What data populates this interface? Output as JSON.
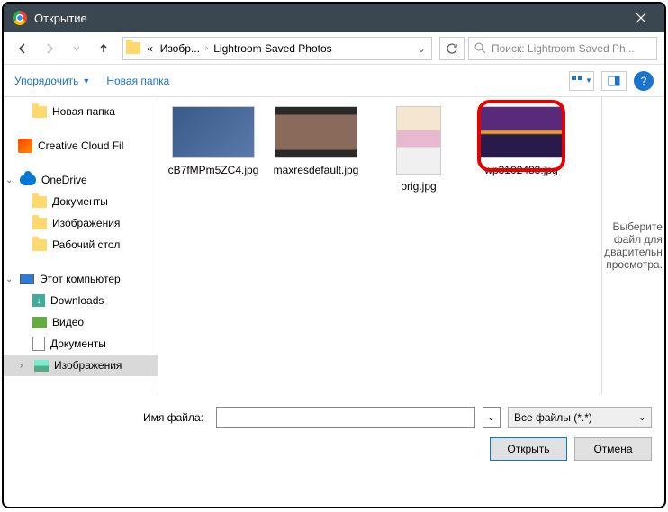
{
  "titlebar": {
    "title": "Открытие"
  },
  "breadcrumb": {
    "prefix": "«",
    "item1": "Изобр...",
    "item2": "Lightroom Saved Photos"
  },
  "search": {
    "placeholder": "Поиск: Lightroom Saved Ph..."
  },
  "toolbar": {
    "organize": "Упорядочить",
    "newfolder": "Новая папка"
  },
  "tree": {
    "items": [
      {
        "label": "Новая папка",
        "icon": "folder",
        "indent": 1
      },
      {
        "label": "Creative Cloud Fil",
        "icon": "cc",
        "indent": 0
      },
      {
        "label": "OneDrive",
        "icon": "cloud",
        "indent": 0,
        "expand": "⌄"
      },
      {
        "label": "Документы",
        "icon": "folder",
        "indent": 1
      },
      {
        "label": "Изображения",
        "icon": "folder",
        "indent": 1
      },
      {
        "label": "Рабочий стол",
        "icon": "folder",
        "indent": 1
      },
      {
        "label": "Этот компьютер",
        "icon": "pc",
        "indent": 0,
        "expand": "⌄"
      },
      {
        "label": "Downloads",
        "icon": "dl",
        "indent": 1
      },
      {
        "label": "Видео",
        "icon": "vid",
        "indent": 1
      },
      {
        "label": "Документы",
        "icon": "doc",
        "indent": 1
      },
      {
        "label": "Изображения",
        "icon": "img",
        "indent": 1,
        "selected": true,
        "expand": "›"
      }
    ]
  },
  "files": [
    {
      "name": "cB7fMPm5ZC4.jpg",
      "thumb": "t1"
    },
    {
      "name": "maxresdefault.jpg",
      "thumb": "t2"
    },
    {
      "name": "orig.jpg",
      "thumb": "t3"
    },
    {
      "name": "wp3102483.jpg",
      "thumb": "t4",
      "highlighted": true
    }
  ],
  "preview": {
    "text": "Выберите файл для дварительн просмотра."
  },
  "bottom": {
    "fname_label": "Имя файла:",
    "fname_value": "",
    "filter": "Все файлы (*.*)",
    "open": "Открыть",
    "cancel": "Отмена"
  }
}
